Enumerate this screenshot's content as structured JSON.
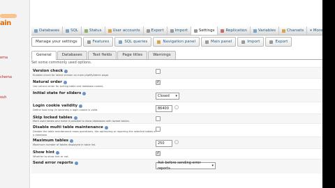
{
  "left": {
    "logo": "ain",
    "items": [
      "ema",
      "chema",
      "ouh"
    ]
  },
  "tabs1": [
    {
      "label": "Databases",
      "icon": "database-icon"
    },
    {
      "label": "SQL",
      "icon": "sql-icon"
    },
    {
      "label": "Status",
      "icon": "status-icon"
    },
    {
      "label": "User accounts",
      "icon": "users-icon"
    },
    {
      "label": "Export",
      "icon": "export-icon"
    },
    {
      "label": "Import",
      "icon": "import-icon"
    },
    {
      "label": "Settings",
      "icon": "wrench-icon"
    },
    {
      "label": "Replication",
      "icon": "replication-icon"
    },
    {
      "label": "Variables",
      "icon": "variables-icon"
    },
    {
      "label": "Charsets",
      "icon": "charsets-icon"
    },
    {
      "label": "More",
      "icon": "chevron-down-icon"
    }
  ],
  "tabs2": [
    {
      "label": "Manage your settings",
      "icon": ""
    },
    {
      "label": "Features",
      "icon": "features-icon"
    },
    {
      "label": "SQL queries",
      "icon": "sql-icon"
    },
    {
      "label": "Navigation panel",
      "icon": "navigation-icon"
    },
    {
      "label": "Main panel",
      "icon": "main-panel-icon"
    },
    {
      "label": "Import",
      "icon": "import-icon"
    },
    {
      "label": "Export",
      "icon": "export-icon"
    }
  ],
  "tabs3": [
    "General",
    "Databases",
    "Text fields",
    "Page titles",
    "Warnings"
  ],
  "subtitle": "Set some commonly used options.",
  "settings": [
    {
      "label": "Version check",
      "desc": "Enables check for latest version on main phpMyAdmin page.",
      "control": "checkbox",
      "checked": false
    },
    {
      "label": "Natural order",
      "desc": "Use natural order for sorting table and database names.",
      "control": "checkbox",
      "checked": true
    },
    {
      "label": "Initial state for sliders",
      "desc": "",
      "control": "select",
      "value": "Closed"
    },
    {
      "label": "Login cookie validity",
      "desc": "Define how long (in seconds) a login cookie is valid.",
      "control": "input",
      "value": "86400"
    },
    {
      "label": "Skip locked tables",
      "desc": "Mark used tables and make it possible to show databases with locked tables.",
      "control": "checkbox",
      "checked": false
    },
    {
      "label": "Disable multi table maintenance",
      "desc": "Disable the table maintenance mass operations, like optimizing or repairing the selected tables of a database.",
      "control": "checkbox",
      "checked": false
    },
    {
      "label": "Maximum tables",
      "desc": "Maximum number of tables displayed in table list.",
      "control": "input",
      "value": "250"
    },
    {
      "label": "Show hint",
      "desc": "Whether to show hint or not.",
      "control": "checkbox",
      "checked": true
    },
    {
      "label": "Send error reports",
      "desc": "",
      "control": "select",
      "value": "Ask before sending error reports"
    }
  ]
}
